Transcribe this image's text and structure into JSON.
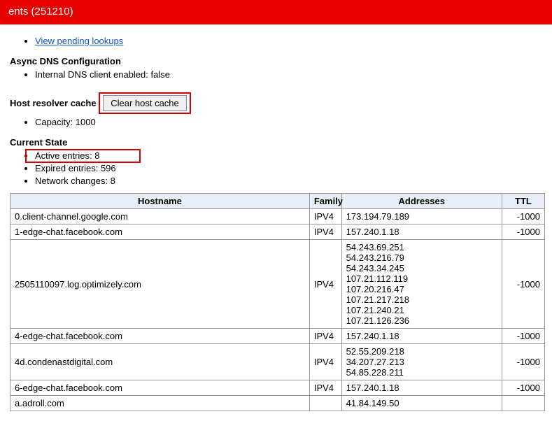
{
  "topbar": {
    "title_fragment": "ents (251210)"
  },
  "links": {
    "pending_lookups": "View pending lookups"
  },
  "sections": {
    "async_dns_title": "Async DNS Configuration",
    "internal_dns_label": "Internal DNS client enabled: ",
    "internal_dns_value": "false",
    "host_resolver_label": "Host resolver cache",
    "clear_button": "Clear host cache",
    "capacity_label": "Capacity: ",
    "capacity_value": "1000",
    "current_state_title": "Current State",
    "active_label": "Active entries: ",
    "active_value": "8",
    "expired_label": "Expired entries: ",
    "expired_value": "596",
    "network_changes_label": "Network changes: ",
    "network_changes_value": "8"
  },
  "table": {
    "headers": {
      "hostname": "Hostname",
      "family": "Family",
      "addresses": "Addresses",
      "ttl": "TTL"
    },
    "rows": [
      {
        "hostname": "0.client-channel.google.com",
        "family": "IPV4",
        "addresses": [
          "173.194.79.189"
        ],
        "ttl": "-1000"
      },
      {
        "hostname": "1-edge-chat.facebook.com",
        "family": "IPV4",
        "addresses": [
          "157.240.1.18"
        ],
        "ttl": "-1000"
      },
      {
        "hostname": "2505110097.log.optimizely.com",
        "family": "IPV4",
        "addresses": [
          "54.243.69.251",
          "54.243.216.79",
          "54.243.34.245",
          "107.21.112.119",
          "107.20.216.47",
          "107.21.217.218",
          "107.21.240.21",
          "107.21.126.236"
        ],
        "ttl": "-1000"
      },
      {
        "hostname": "4-edge-chat.facebook.com",
        "family": "IPV4",
        "addresses": [
          "157.240.1.18"
        ],
        "ttl": "-1000"
      },
      {
        "hostname": "4d.condenastdigital.com",
        "family": "IPV4",
        "addresses": [
          "52.55.209.218",
          "34.207.27.213",
          "54.85.228.211"
        ],
        "ttl": "-1000"
      },
      {
        "hostname": "6-edge-chat.facebook.com",
        "family": "IPV4",
        "addresses": [
          "157.240.1.18"
        ],
        "ttl": "-1000"
      },
      {
        "hostname": "a.adroll.com",
        "family": "",
        "addresses": [
          "41.84.149.50"
        ],
        "ttl": ""
      }
    ]
  }
}
